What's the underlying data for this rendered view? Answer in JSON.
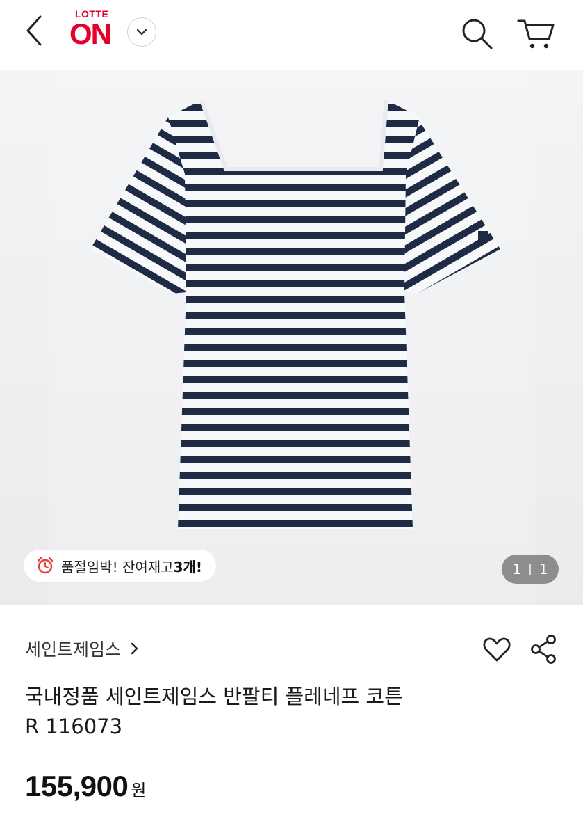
{
  "header": {
    "logo_top": "LOTTE",
    "logo_main": "ON"
  },
  "gallery": {
    "stock_text": "품절임박! 잔여재고 ",
    "stock_count": "3개!",
    "pager_current": "1",
    "pager_total": "1"
  },
  "product": {
    "brand": "세인트제임스",
    "title_line1": "국내정품 세인트제임스 반팔티 플레네프 코튼",
    "title_line2": "R 116073",
    "price": "155,900",
    "price_unit": "원"
  },
  "colors": {
    "brand_red": "#e4002b",
    "stripe_navy": "#1f2a44"
  },
  "icons": [
    "back-icon",
    "chevron-down-icon",
    "search-icon",
    "cart-icon",
    "alarm-clock-icon",
    "chevron-right-icon",
    "heart-icon",
    "share-icon"
  ]
}
